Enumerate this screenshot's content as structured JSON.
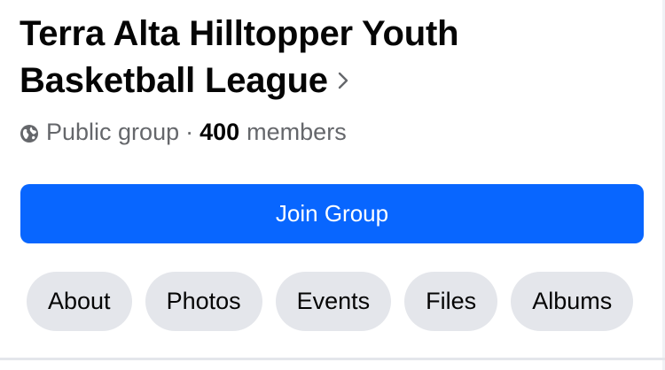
{
  "group": {
    "title": "Terra Alta Hilltopper Youth Basketball League",
    "privacy": "Public group",
    "separator": "·",
    "member_count": "400",
    "members_label": "members"
  },
  "actions": {
    "join_label": "Join Group"
  },
  "tabs": [
    {
      "label": "About"
    },
    {
      "label": "Photos"
    },
    {
      "label": "Events"
    },
    {
      "label": "Files"
    },
    {
      "label": "Albums"
    }
  ],
  "colors": {
    "primary": "#0866ff",
    "tab_background": "#e4e6eb",
    "secondary_text": "#65676b"
  },
  "icons": [
    "globe-icon",
    "chevron-right-icon"
  ]
}
